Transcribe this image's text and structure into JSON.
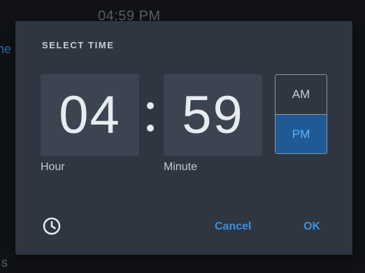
{
  "background": {
    "time_text": "04:59 PM",
    "left_fragment": "ne",
    "bottom_fragment": "s"
  },
  "dialog": {
    "title": "SELECT TIME",
    "hour_value": "04",
    "minute_value": "59",
    "hour_label": "Hour",
    "minute_label": "Minute",
    "am_label": "AM",
    "pm_label": "PM",
    "selected_period": "PM",
    "clock_icon": "clock-icon",
    "cancel_label": "Cancel",
    "ok_label": "OK"
  },
  "colors": {
    "dialog_bg": "#2d3641",
    "box_bg": "#3b4450",
    "accent": "#3d8fe0",
    "selected_bg": "#1f5a96"
  }
}
